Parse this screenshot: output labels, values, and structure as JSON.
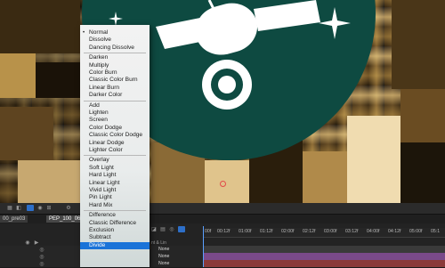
{
  "blend_menu": {
    "items": [
      {
        "label": "Normal",
        "group": 1,
        "checked": true
      },
      {
        "label": "Dissolve",
        "group": 1
      },
      {
        "label": "Dancing Dissolve",
        "group": 1
      },
      {
        "label": "Darken",
        "group": 2
      },
      {
        "label": "Multiply",
        "group": 2
      },
      {
        "label": "Color Burn",
        "group": 2
      },
      {
        "label": "Classic Color Burn",
        "group": 2
      },
      {
        "label": "Linear Burn",
        "group": 2
      },
      {
        "label": "Darker Color",
        "group": 2
      },
      {
        "label": "Add",
        "group": 3
      },
      {
        "label": "Lighten",
        "group": 3
      },
      {
        "label": "Screen",
        "group": 3
      },
      {
        "label": "Color Dodge",
        "group": 3
      },
      {
        "label": "Classic Color Dodge",
        "group": 3
      },
      {
        "label": "Linear Dodge",
        "group": 3
      },
      {
        "label": "Lighter Color",
        "group": 3
      },
      {
        "label": "Overlay",
        "group": 4
      },
      {
        "label": "Soft Light",
        "group": 4
      },
      {
        "label": "Hard Light",
        "group": 4
      },
      {
        "label": "Linear Light",
        "group": 4
      },
      {
        "label": "Vivid Light",
        "group": 4
      },
      {
        "label": "Pin Light",
        "group": 4
      },
      {
        "label": "Hard Mix",
        "group": 4
      },
      {
        "label": "Difference",
        "group": 5
      },
      {
        "label": "Classic Difference",
        "group": 5
      },
      {
        "label": "Exclusion",
        "group": 5
      },
      {
        "label": "Subtract",
        "group": 5
      },
      {
        "label": "Divide",
        "group": 5,
        "selected": true
      }
    ]
  },
  "comp_tabs": [
    {
      "label": "00_pre03",
      "active": false
    },
    {
      "label": "PEP_100_060_j",
      "active": true
    }
  ],
  "timeline": {
    "ticks": [
      "00f",
      "00:12f",
      "01:00f",
      "01:12f",
      "02:00f",
      "02:12f",
      "03:00f",
      "03:12f",
      "04:00f",
      "04:12f",
      "05:00f",
      "05:1"
    ],
    "mode_header": "nt & Lin",
    "layer_modes": [
      "None",
      "None",
      "None",
      "None"
    ]
  },
  "colors": {
    "emblem": "#0e4a41",
    "menu_selection": "#1a73d8",
    "track_purple": "#7a4a8a",
    "track_red": "#8a3a3a",
    "playhead": "#5aa0ff"
  }
}
